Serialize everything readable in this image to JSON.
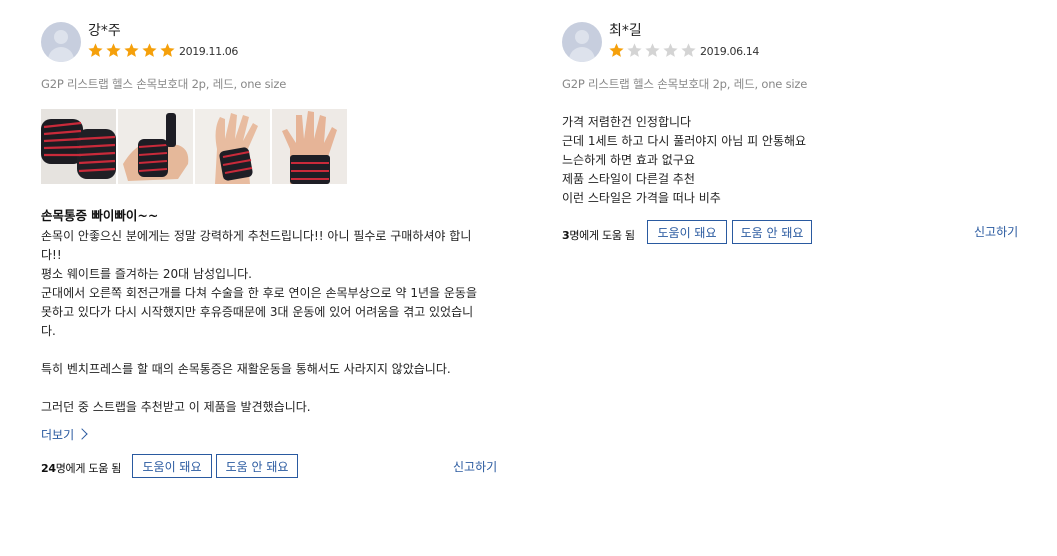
{
  "reviews": [
    {
      "reviewer": "강*주",
      "rating": 5,
      "rating_max": 5,
      "date": "2019.11.06",
      "option": "G2P 리스트랩 헬스 손목보호대 2p, 레드, one size",
      "photos": [
        "wrist-wrap-photo-1",
        "wrist-wrap-photo-2",
        "wrist-wrap-photo-3",
        "wrist-wrap-photo-4"
      ],
      "headline": "손목통증 빠이빠이~~",
      "content": [
        "손목이 안좋으신 분에게는 정말 강력하게 추천드립니다!! 아니 필수로 구매하셔야 합니",
        "다!!",
        "평소 웨이트를 즐겨하는 20대 남성입니다.",
        "군대에서 오른쪽 회전근개를 다쳐 수술을 한 후로 연이은 손목부상으로 약 1년을 운동을",
        "못하고 있다가 다시 시작했지만 후유증때문에 3대 운동에 있어 어려움을 겪고 있었습니",
        "다.",
        "",
        "특히 벤치프레스를 할 때의 손목통증은 재활운동을 통해서도 사라지지 않았습니다.",
        "",
        "그러던 중 스트랩을 추천받고 이 제품을 발견했습니다."
      ],
      "more_label": "더보기",
      "helpful_count": "24",
      "helpful_suffix": "명에게 도움 됨",
      "helpful_yes_label": "도움이 돼요",
      "helpful_no_label": "도움 안 돼요",
      "report_label": "신고하기"
    },
    {
      "reviewer": "최*길",
      "rating": 1,
      "rating_max": 5,
      "date": "2019.06.14",
      "option": "G2P 리스트랩 헬스 손목보호대 2p, 레드, one size",
      "content": [
        "가격 저렴한건 인정합니다",
        "근데 1세트 하고 다시 풀러야지 아님 피 안통해요",
        "느슨하게 하면 효과 없구요",
        "제품 스타일이 다른걸 추천",
        "이런 스타일은 가격을 떠나 비추"
      ],
      "helpful_count": "3",
      "helpful_suffix": "명에게 도움 됨",
      "helpful_yes_label": "도움이 돼요",
      "helpful_no_label": "도움 안 돼요",
      "report_label": "신고하기"
    }
  ],
  "colors": {
    "star_filled": "#f5a00b",
    "star_empty": "#d4d4d4",
    "accent": "#2a5aa0",
    "muted": "#888888"
  }
}
